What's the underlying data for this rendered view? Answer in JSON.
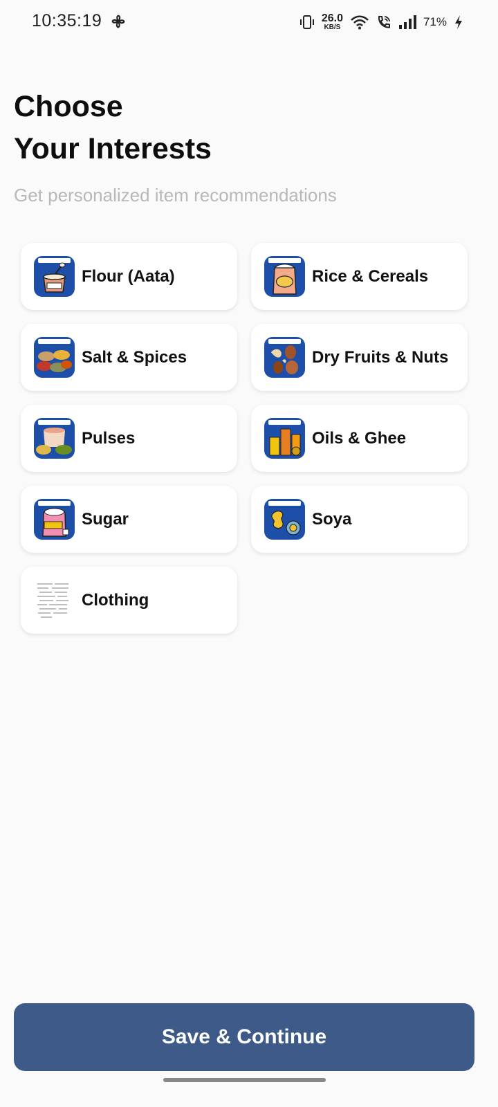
{
  "status_bar": {
    "time": "10:35:19",
    "net_speed_value": "26.0",
    "net_speed_unit": "KB/S",
    "battery": "71%",
    "icons": [
      "fan-icon",
      "vibrate-icon",
      "wifi-icon",
      "wifi-calling-icon",
      "signal-icon",
      "charging-icon"
    ]
  },
  "header": {
    "title_line1": "Choose",
    "title_line2": "Your Interests",
    "subtitle": "Get personalized item recommendations"
  },
  "interests": [
    {
      "label": "Flour (Aata)",
      "icon": "flour-icon"
    },
    {
      "label": "Rice & Cereals",
      "icon": "rice-icon"
    },
    {
      "label": "Salt & Spices",
      "icon": "spices-icon"
    },
    {
      "label": "Dry Fruits & Nuts",
      "icon": "dry-fruits-icon"
    },
    {
      "label": "Pulses",
      "icon": "pulses-icon"
    },
    {
      "label": "Oils & Ghee",
      "icon": "oil-icon"
    },
    {
      "label": "Sugar",
      "icon": "sugar-icon"
    },
    {
      "label": "Soya",
      "icon": "soya-icon"
    },
    {
      "label": "Clothing",
      "icon": "clothing-icon"
    }
  ],
  "footer": {
    "save_label": "Save & Continue"
  },
  "colors": {
    "primary": "#3d5a88",
    "thumb_bg": "#1d4fa8",
    "subtitle": "#b8b8bc"
  }
}
